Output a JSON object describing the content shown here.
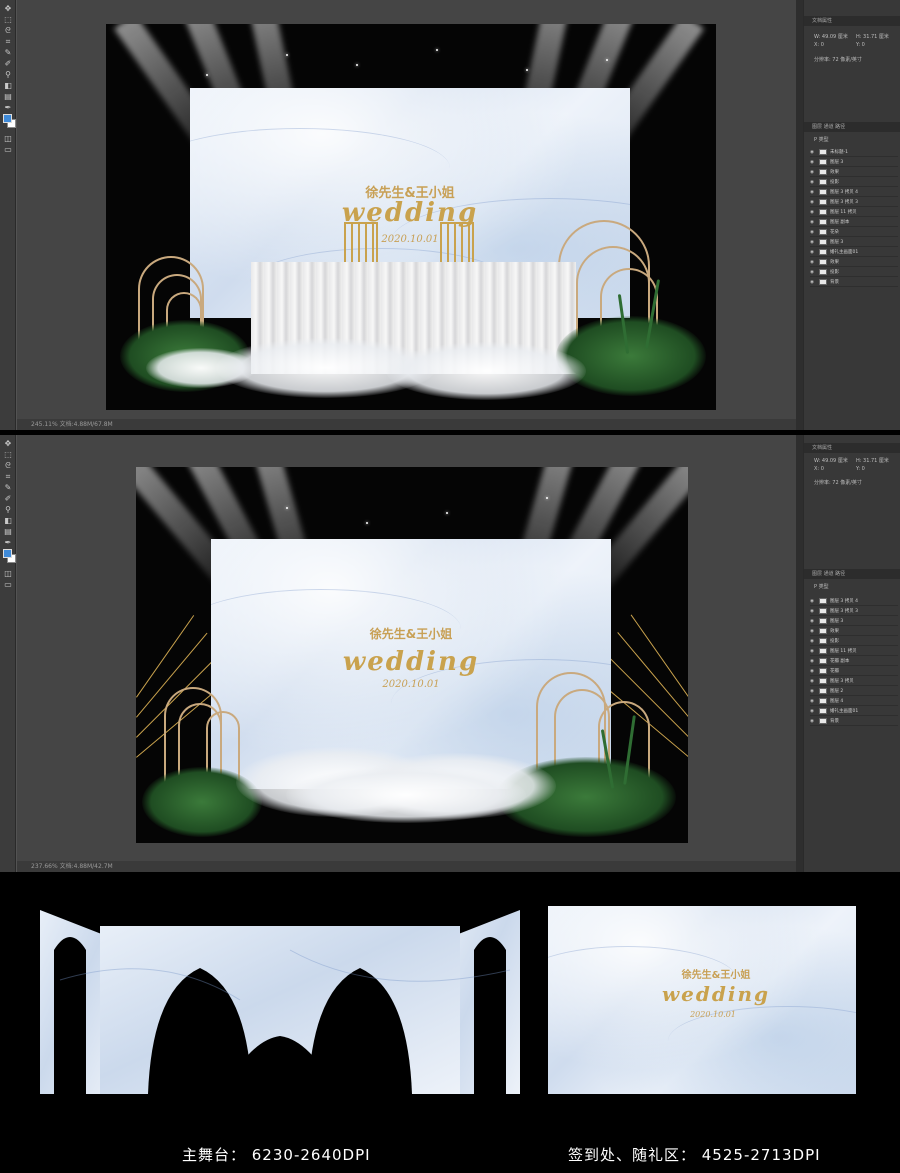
{
  "window1": {
    "status": "245.11%    文档:4.88M/67.8M",
    "properties": {
      "tab": "文档属性",
      "w": "W: 49.09 厘米",
      "h": "H: 31.71 厘米",
      "x": "X: 0",
      "y": "Y: 0",
      "res": "分辨率: 72 像素/英寸"
    },
    "layers_tabs": "图层   通道   路径",
    "layers_filter": "P 类型",
    "layers": [
      "未标题-1",
      "图层 3",
      "效果",
      "投影",
      "图层 3 拷贝 4",
      "图层 3 拷贝 3",
      "图层 11 拷贝",
      "图层 副本",
      "花朵",
      "图层 3",
      "婚礼主画面01",
      "效果",
      "投影",
      "背景"
    ]
  },
  "window2": {
    "status": "237.66%    文档:4.88M/42.7M",
    "properties": {
      "tab": "文档属性",
      "w": "W: 49.09 厘米",
      "h": "H: 31.71 厘米",
      "x": "X: 0",
      "y": "Y: 0",
      "res": "分辨率: 72 像素/英寸"
    },
    "layers_tabs": "图层   通道   路径",
    "layers_filter": "P 类型",
    "layers": [
      "图层 3 拷贝 4",
      "图层 3 拷贝 3",
      "图层 3",
      "效果",
      "投影",
      "图层 11 拷贝",
      "花瓣 副本",
      "花瓣",
      "图层 3 拷贝",
      "图层 2",
      "图层 4",
      "婚礼主画面01",
      "背景"
    ]
  },
  "design": {
    "names": "徐先生&王小姐",
    "wedding": "wedding",
    "date": "2020.10.01"
  },
  "captions": {
    "main_stage": "主舞台：  6230-2640DPI",
    "sign_in": "签到处、随礼区：  4525-2713DPI"
  },
  "colors": {
    "gold": "#c9a24d",
    "marble": "#dfe8f4",
    "ps_gray": "#535353",
    "fg_swatch": "#3f8ad8"
  },
  "icons": [
    "move-icon",
    "marquee-icon",
    "lasso-icon",
    "crop-icon",
    "eyedropper-icon",
    "brush-icon",
    "stamp-icon",
    "eraser-icon",
    "gradient-icon",
    "pen-icon",
    "type-icon",
    "path-select-icon",
    "shape-icon",
    "hand-icon",
    "zoom-icon",
    "eye-icon"
  ]
}
